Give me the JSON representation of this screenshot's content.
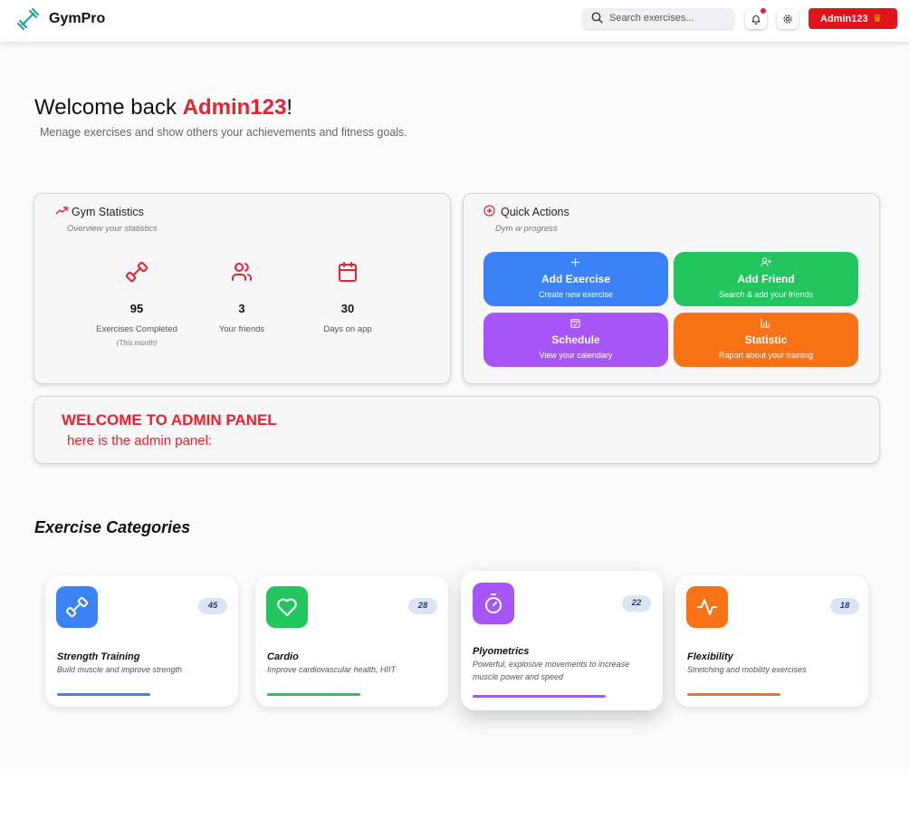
{
  "nav": {
    "brand": "GymPro",
    "search_placeholder": "Search exercises...",
    "user_button": "Admin123",
    "crown_glyph": "♛"
  },
  "hero": {
    "greeting": "Welcome back ",
    "username": "Admin123",
    "exclaim": "!",
    "subtitle": "Menage exercises and show others your achievements and fitness goals."
  },
  "stats_card": {
    "title": "Gym Statistics",
    "subtitle": "Overview your statistics",
    "items": [
      {
        "icon": "dumbbell-icon",
        "value": "95",
        "label": "Exercises Completed",
        "note": "(This month)"
      },
      {
        "icon": "users-icon",
        "value": "3",
        "label": "Your friends",
        "note": ""
      },
      {
        "icon": "calendar-icon",
        "value": "30",
        "label": "Days on app",
        "note": ""
      }
    ]
  },
  "quick_actions": {
    "title": "Quick Actions",
    "subtitle": "Dym w progress",
    "actions": [
      {
        "title": "Add Exercise",
        "subtitle": "Create new exercise",
        "color": "#3b82f6",
        "icon": "plus-icon"
      },
      {
        "title": "Add Friend",
        "subtitle": "Search & add your friends",
        "color": "#22c55e",
        "icon": "user-plus-icon"
      },
      {
        "title": "Schedule",
        "subtitle": "View your calendary",
        "color": "#a855f7",
        "icon": "calendar-check-icon"
      },
      {
        "title": "Statistic",
        "subtitle": "Raport about your training",
        "color": "#f97316",
        "icon": "bar-chart-icon"
      }
    ]
  },
  "admin_panel": {
    "title": "WELCOME TO ADMIN PANEL",
    "subtitle": "here is the admin panel:"
  },
  "categories": {
    "heading": "Exercise Categories",
    "items": [
      {
        "name": "Strength Training",
        "description": "Build muscle and improve strength",
        "count": "45",
        "color": "#3b82f6",
        "icon": "dumbbell-icon"
      },
      {
        "name": "Cardio",
        "description": "Improve cardiovascular health, HIIT",
        "count": "28",
        "color": "#22c55e",
        "icon": "heart-icon"
      },
      {
        "name": "Plyometrics",
        "description": "Powerful, explosive movements to increase muscle power and speed",
        "count": "22",
        "color": "#a855f7",
        "icon": "stopwatch-icon"
      },
      {
        "name": "Flexibility",
        "description": "Stretching and mobility exercises",
        "count": "18",
        "color": "#f97316",
        "icon": "activity-icon"
      }
    ]
  },
  "colors": {
    "accent_red": "#e8222e",
    "admin_button": "#e0141c"
  }
}
